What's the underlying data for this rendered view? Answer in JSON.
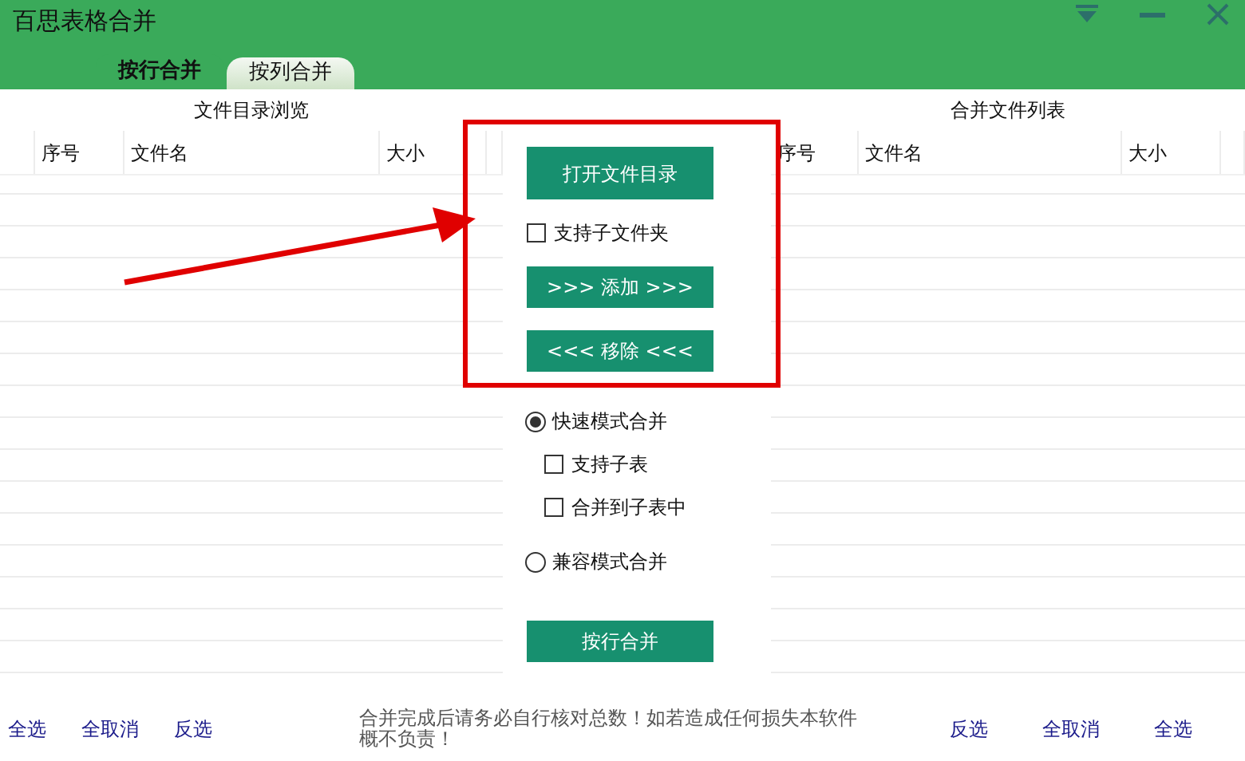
{
  "window": {
    "title": "百思表格合并"
  },
  "tabs": [
    {
      "label": "按行合并",
      "selected": true
    },
    {
      "label": "按列合并",
      "selected": false
    }
  ],
  "left_list": {
    "title": "文件目录浏览",
    "columns": [
      "序号",
      "文件名",
      "大小"
    ]
  },
  "right_list": {
    "title": "合并文件列表",
    "columns": [
      "序号",
      "文件名",
      "大小"
    ]
  },
  "middle": {
    "open_button": "打开文件目录",
    "include_subfolders": {
      "label": "支持子文件夹",
      "checked": false
    },
    "add_button": ">>> 添加 >>>",
    "remove_button": "<<< 移除 <<<",
    "modes": [
      {
        "label": "快速模式合并",
        "selected": true,
        "options": [
          {
            "label": "支持子表",
            "checked": false
          },
          {
            "label": "合并到子表中",
            "checked": false
          }
        ]
      },
      {
        "label": "兼容模式合并",
        "selected": false
      }
    ],
    "merge_button": "按行合并"
  },
  "footer": {
    "left_links": [
      "全选",
      "全取消",
      "反选"
    ],
    "notice": "合并完成后请务必自行核对总数！如若造成任何损失本软件概不负责！",
    "right_links": [
      "反选",
      "全取消",
      "全选"
    ]
  }
}
